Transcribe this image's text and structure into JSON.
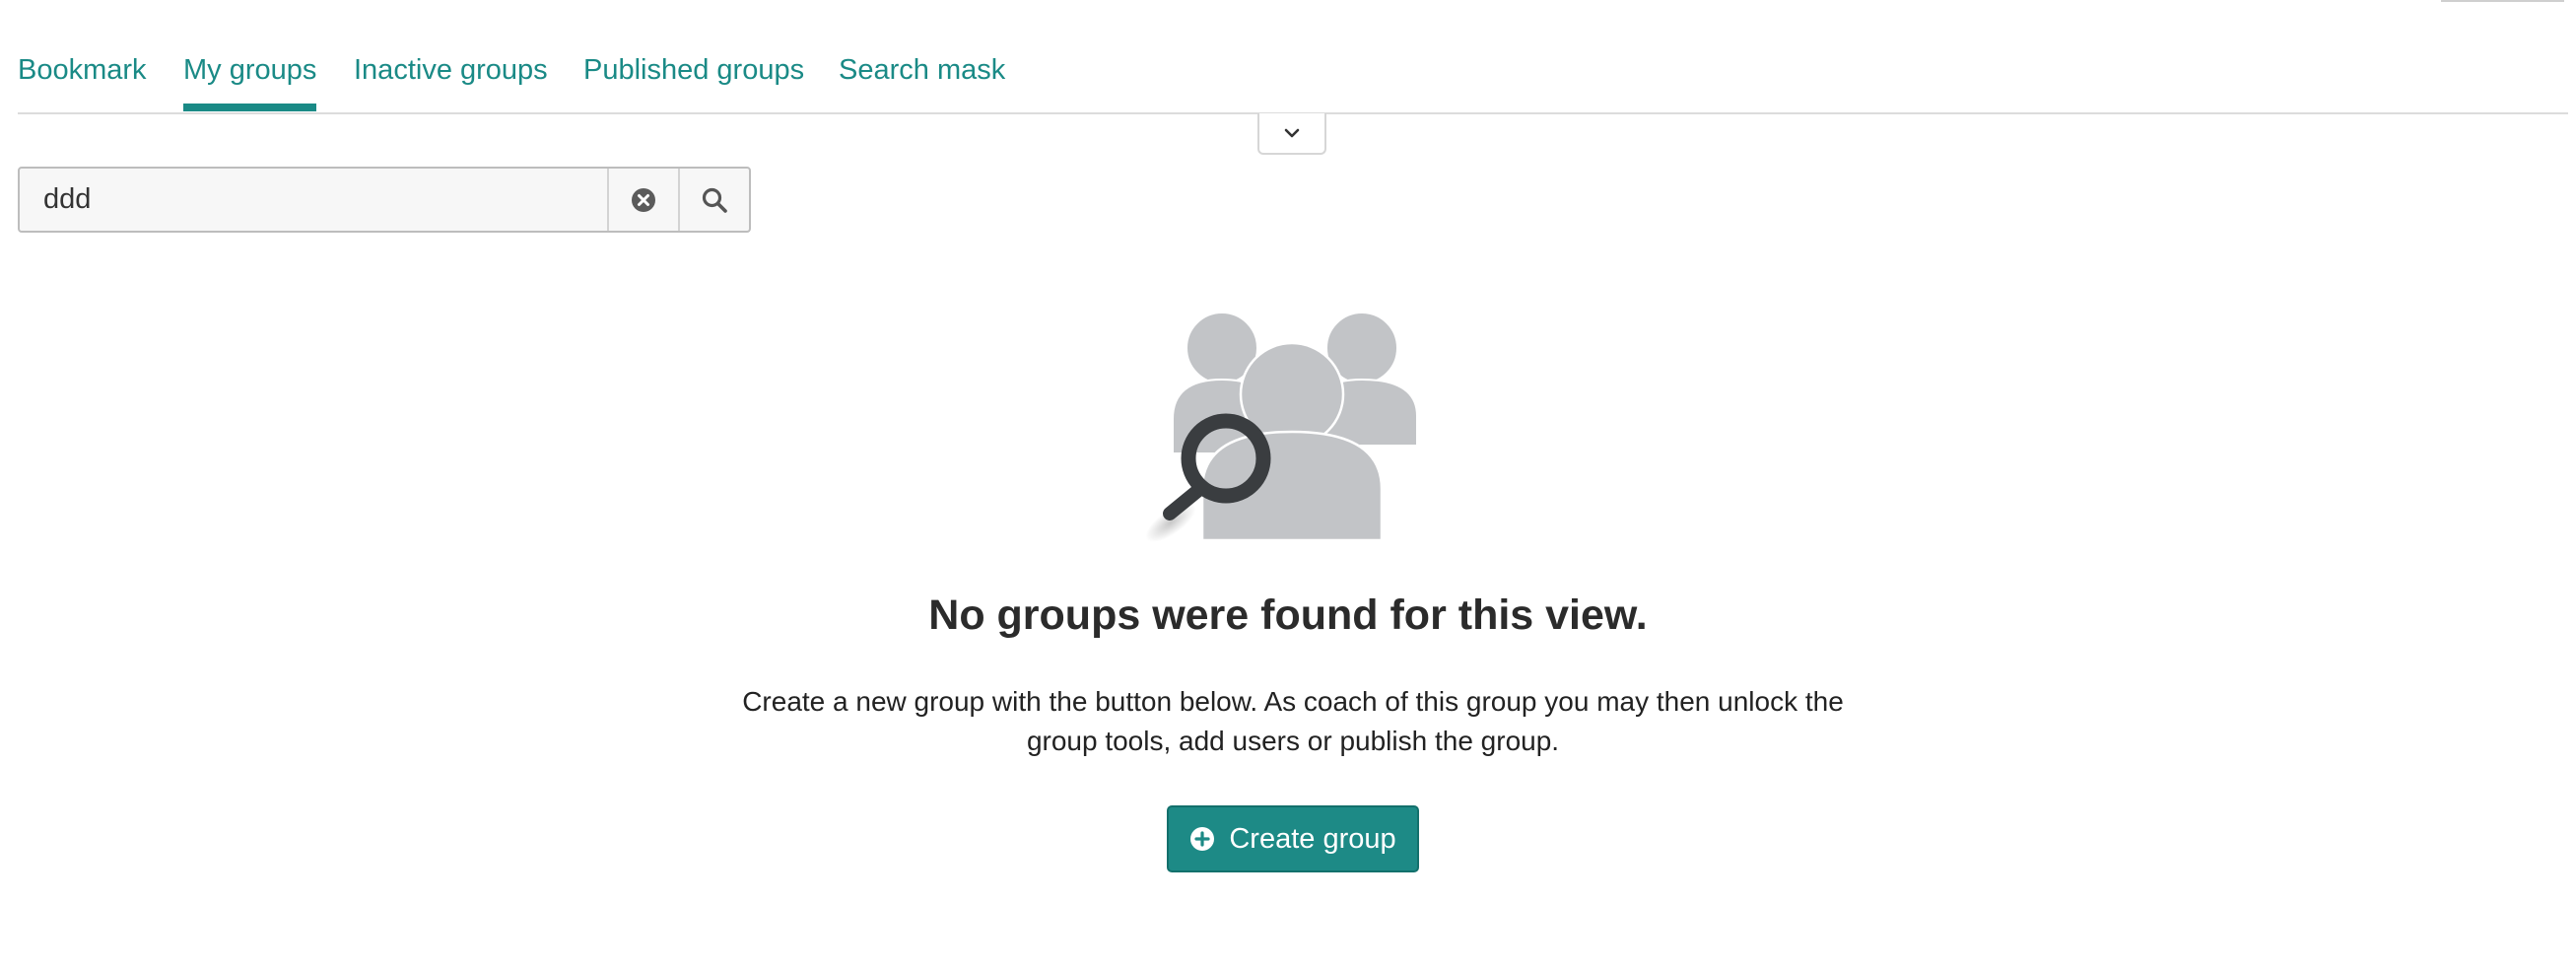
{
  "tabs": [
    {
      "label": "Bookmark",
      "active": false
    },
    {
      "label": "My groups",
      "active": true
    },
    {
      "label": "Inactive groups",
      "active": false
    },
    {
      "label": "Published groups",
      "active": false
    },
    {
      "label": "Search mask",
      "active": false
    }
  ],
  "search": {
    "value": "ddd"
  },
  "icons": {
    "expand": "chevron-down-icon",
    "clear": "clear-circle-icon",
    "search": "magnifier-icon",
    "empty_state": "group-search-illustration",
    "create": "plus-circle-icon"
  },
  "empty_state": {
    "title": "No groups were found for this view.",
    "description": "Create a new group with the button below. As coach of this group you may then unlock the group tools, add users or publish the group."
  },
  "create_button": {
    "label": "Create group"
  },
  "colors": {
    "accent": "#1a8a86",
    "button": "#1d8a86",
    "illustration": "#c2c4c7",
    "magnifier": "#3a3d40"
  }
}
